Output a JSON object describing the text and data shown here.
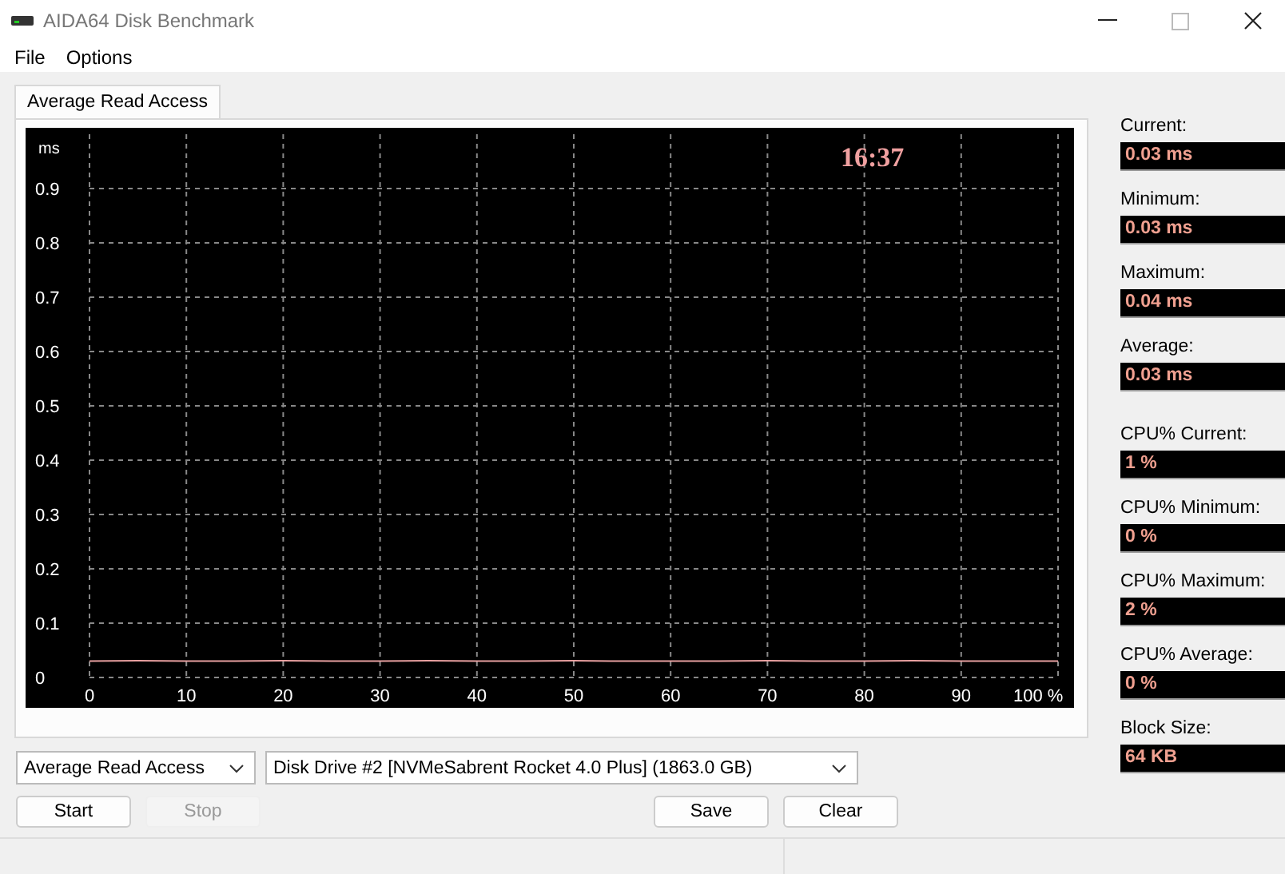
{
  "window": {
    "title": "AIDA64 Disk Benchmark"
  },
  "menu": [
    "File",
    "Options"
  ],
  "tabs": [
    {
      "label": "Average Read Access",
      "selected": true
    }
  ],
  "chart": {
    "unit_label": "ms",
    "clock": "16:37",
    "chart_data": {
      "type": "line",
      "xlim": [
        0,
        100
      ],
      "ylim": [
        0,
        1
      ],
      "xticks": [
        0,
        10,
        20,
        30,
        40,
        50,
        60,
        70,
        80,
        90,
        {
          "value": 100,
          "label": "100 %"
        }
      ],
      "yticks": [
        0,
        0.1,
        0.2,
        0.3,
        0.4,
        0.5,
        0.6,
        0.7,
        0.8,
        0.9
      ],
      "x": [
        0,
        5,
        10,
        15,
        20,
        25,
        30,
        35,
        40,
        45,
        50,
        55,
        60,
        65,
        70,
        75,
        80,
        85,
        90,
        95,
        100
      ],
      "grid": true,
      "series": [
        {
          "color": "#e8a0a0",
          "values": [
            0.03,
            0.031,
            0.03,
            0.03,
            0.031,
            0.03,
            0.03,
            0.031,
            0.03,
            0.03,
            0.031,
            0.03,
            0.03,
            0.03,
            0.031,
            0.03,
            0.03,
            0.031,
            0.03,
            0.03,
            0.03
          ]
        }
      ]
    }
  },
  "access_stats": [
    {
      "label": "Current:",
      "value": "0.03 ms"
    },
    {
      "label": "Minimum:",
      "value": "0.03 ms"
    },
    {
      "label": "Maximum:",
      "value": "0.04 ms"
    },
    {
      "label": "Average:",
      "value": "0.03 ms"
    }
  ],
  "cpu_stats": [
    {
      "label": "CPU% Current:",
      "value": "1 %"
    },
    {
      "label": "CPU% Minimum:",
      "value": "0 %"
    },
    {
      "label": "CPU% Maximum:",
      "value": "2 %"
    },
    {
      "label": "CPU% Average:",
      "value": "0 %"
    },
    {
      "label": "Block Size:",
      "value": "64 KB"
    }
  ],
  "mode_select": {
    "value": "Average Read Access"
  },
  "drive_select": {
    "value": "Disk Drive #2  [NVMeSabrent Rocket 4.0 Plus]  (1863.0 GB)"
  },
  "buttons_left": [
    {
      "label": "Start",
      "disabled": false
    },
    {
      "label": "Stop",
      "disabled": true
    }
  ],
  "buttons_right": [
    {
      "label": "Save",
      "disabled": false
    },
    {
      "label": "Clear",
      "disabled": false
    }
  ]
}
